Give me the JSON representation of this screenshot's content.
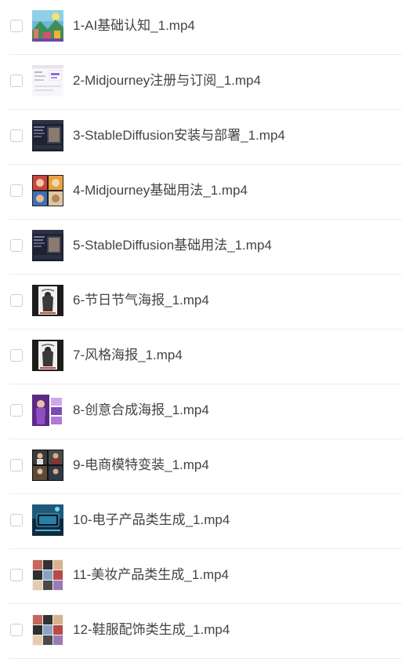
{
  "files": [
    {
      "name": "1-AI基础认知_1.mp4",
      "thumbnail": "colorful-fantasy-landscape"
    },
    {
      "name": "2-Midjourney注册与订阅_1.mp4",
      "thumbnail": "web-signup-page"
    },
    {
      "name": "3-StableDiffusion安装与部署_1.mp4",
      "thumbnail": "dark-software-interface"
    },
    {
      "name": "4-Midjourney基础用法_1.mp4",
      "thumbnail": "colorful-portrait-grid"
    },
    {
      "name": "5-StableDiffusion基础用法_1.mp4",
      "thumbnail": "dark-software-interface"
    },
    {
      "name": "6-节日节气海报_1.mp4",
      "thumbnail": "ink-figure-poster"
    },
    {
      "name": "7-风格海报_1.mp4",
      "thumbnail": "ink-figure-poster"
    },
    {
      "name": "8-创意合成海报_1.mp4",
      "thumbnail": "purple-creative-poster"
    },
    {
      "name": "9-电商模特变装_1.mp4",
      "thumbnail": "model-photo-grid"
    },
    {
      "name": "10-电子产品类生成_1.mp4",
      "thumbnail": "blue-tech-product"
    },
    {
      "name": "11-美妆产品类生成_1.mp4",
      "thumbnail": "product-photo-grid"
    },
    {
      "name": "12-鞋服配饰类生成_1.mp4",
      "thumbnail": "product-photo-grid"
    }
  ]
}
